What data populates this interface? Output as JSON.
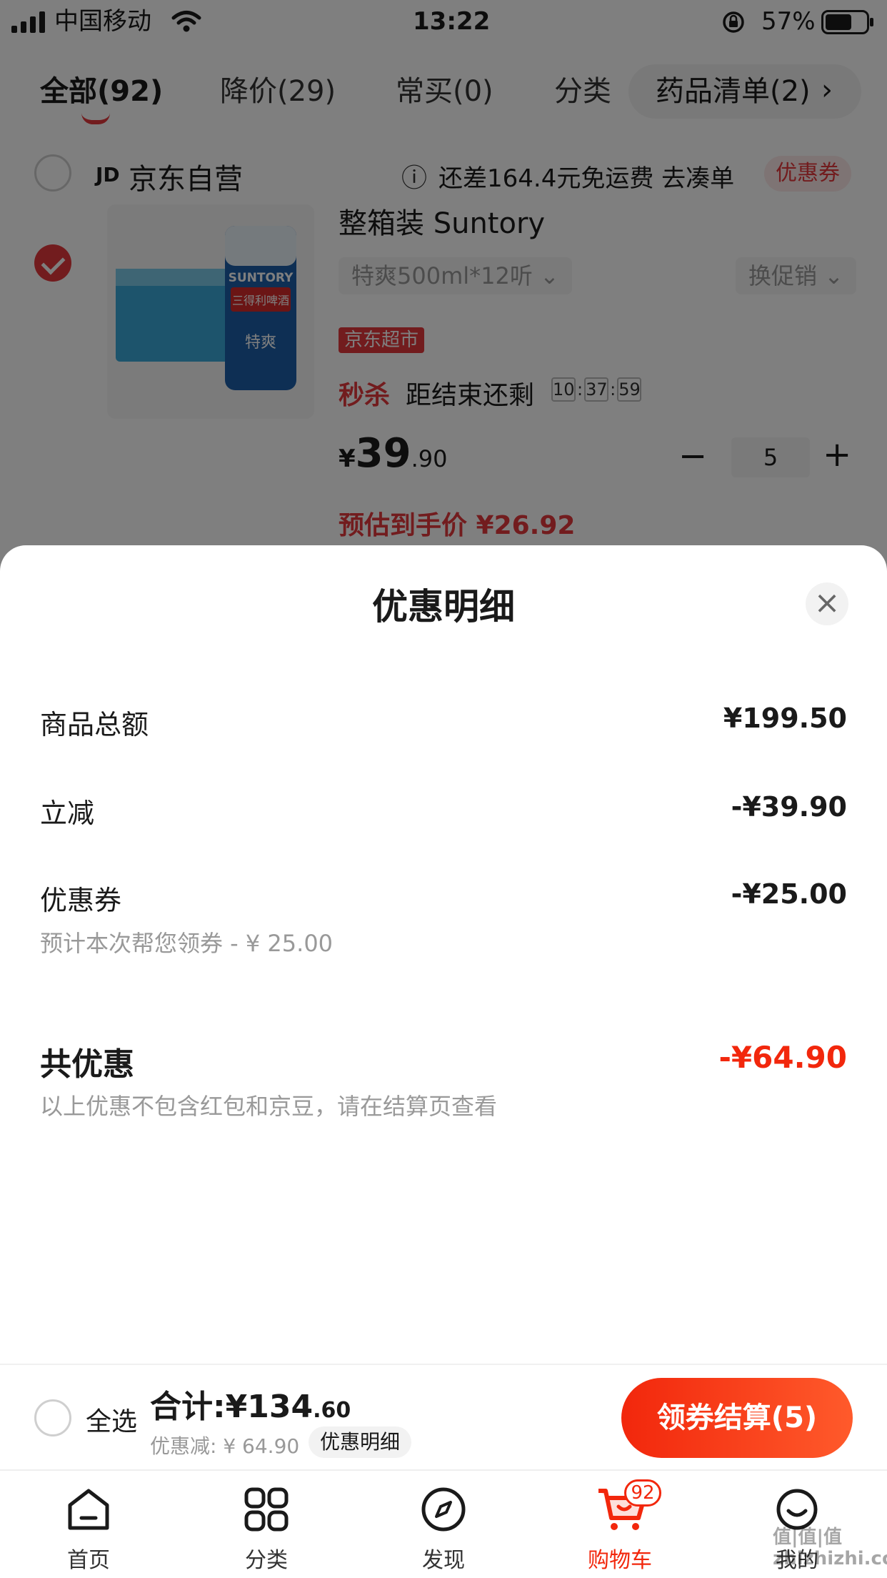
{
  "status_bar": {
    "carrier": "中国移动",
    "time": "13:22",
    "battery": "57%"
  },
  "tabs": {
    "items": [
      {
        "label": "全部(92)"
      },
      {
        "label": "降价(29)"
      },
      {
        "label": "常买(0)"
      },
      {
        "label": "分类"
      }
    ],
    "drug_list": "药品清单(2)",
    "drug_chevron": "›"
  },
  "store": {
    "logo": "JD",
    "name": "京东自营",
    "info_icon": "ⓘ",
    "shipping_text": "还差164.4元免运费 去凑单",
    "coupon_tag": "优惠券"
  },
  "product": {
    "title": "整箱装 Suntory",
    "spec": "特爽500ml*12听 ⌄",
    "promo_switch": "换促销 ⌄",
    "market_tag": "京东超市",
    "flash_label": "秒杀",
    "countdown_label": "距结束还剩",
    "countdown": [
      "10",
      "37",
      "59"
    ],
    "price_symbol": "¥",
    "price_int": "39",
    "price_dec": ".90",
    "quantity": "5",
    "minus": "−",
    "plus": "+",
    "estimate": "预估到手价 ¥26.92",
    "image": {
      "brand": "SUNTORY",
      "cn": "三得利啤酒",
      "variant": "特爽"
    }
  },
  "sheet": {
    "title": "优惠明细",
    "close": "×",
    "rows": [
      {
        "label": "商品总额",
        "value": "¥199.50"
      },
      {
        "label": "立减",
        "value": "-¥39.90"
      },
      {
        "label": "优惠券",
        "value": "-¥25.00",
        "sub": "预计本次帮您领券 - ¥ 25.00"
      }
    ],
    "total": {
      "label": "共优惠",
      "value": "-¥64.90",
      "note": "以上优惠不包含红包和京豆，请在结算页查看"
    }
  },
  "action_bar": {
    "select_all": "全选",
    "total_label": "合计:",
    "total_int": "¥134",
    "total_dec": ".60",
    "discount": "优惠减: ¥ 64.90",
    "details_btn": "优惠明细",
    "checkout": "领券结算(5)"
  },
  "nav": {
    "items": [
      {
        "label": "首页",
        "icon": "home-icon"
      },
      {
        "label": "分类",
        "icon": "grid-icon"
      },
      {
        "label": "发现",
        "icon": "compass-icon"
      },
      {
        "label": "购物车",
        "icon": "cart-icon",
        "badge": "92"
      },
      {
        "label": "我的",
        "icon": "smiley-icon"
      }
    ]
  },
  "watermark": "值|值|值 zhizhizhi.com",
  "colors": {
    "accent": "#e4393c",
    "checkout_start": "#f2270c",
    "checkout_end": "#ff5a2b",
    "overlay": "rgba(0,0,0,0.5)"
  }
}
